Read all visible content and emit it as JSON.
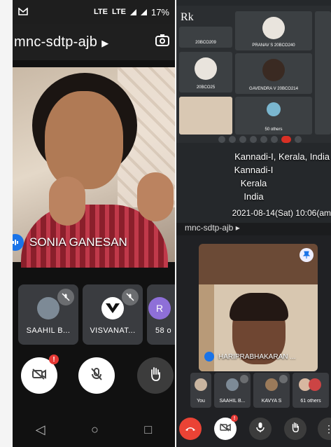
{
  "status_bar": {
    "carrier_icon": "gmail-icon",
    "network1": "LTE",
    "network2": "LTE",
    "battery": "17%"
  },
  "meet_header": {
    "meeting_code": "mnc-sdtp-ajb",
    "switch_camera_icon": "switch-camera-icon"
  },
  "main_speaker": {
    "name": "SONIA GANESAN"
  },
  "participants": [
    {
      "name": "SAAHIL B...",
      "muted": true
    },
    {
      "name": "VISVANAT...",
      "muted": true
    },
    {
      "name": "58 o",
      "initial": "R"
    }
  ],
  "controls": {
    "camera_icon": "camera-off-icon",
    "mic_icon": "mic-off-icon",
    "hand_icon": "raise-hand-icon",
    "badge": "!"
  },
  "nav": {
    "back": "◁",
    "home": "○",
    "recent": "□"
  },
  "laptop_grid": {
    "logo": "Rk",
    "tiles": [
      {
        "caption": "20BCO209"
      },
      {
        "caption": "PRANAV S 20BCO240"
      },
      {
        "caption": "20BCO25"
      },
      {
        "caption": "GAVENDRA V 20BCO214"
      },
      {
        "caption": "50 others"
      }
    ]
  },
  "geo_tag": {
    "line1": "Kannadi-I, Kerala, India",
    "line2": "Kannadi-I",
    "line3": "Kerala",
    "line4": "India",
    "timestamp": "2021-08-14(Sat)  10:06(am"
  },
  "phone2": {
    "header": "mnc-sdtp-ajb ▸",
    "pinned_name": "HARIPRABHAKARAN ...",
    "strip": [
      {
        "caption": "You"
      },
      {
        "caption": "SAAHIL B..."
      },
      {
        "caption": "KAVYA S"
      },
      {
        "caption": "61 others"
      }
    ]
  }
}
